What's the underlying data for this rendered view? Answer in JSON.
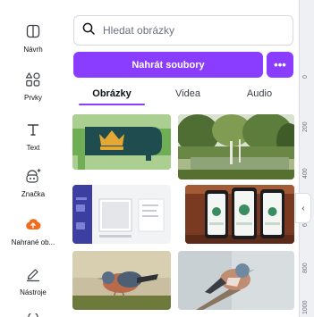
{
  "rail": {
    "items": [
      {
        "label": "Návrh",
        "icon": "layout-icon"
      },
      {
        "label": "Prvky",
        "icon": "shapes-icon"
      },
      {
        "label": "Text",
        "icon": "text-icon"
      },
      {
        "label": "Značka",
        "icon": "brand-icon"
      },
      {
        "label": "Nahrané ob...",
        "icon": "upload-cloud-icon"
      },
      {
        "label": "Nástroje",
        "icon": "draw-tool-icon"
      }
    ],
    "active_index": 4,
    "accent_color": "#f26a1b"
  },
  "search": {
    "placeholder": "Hledat obrázky"
  },
  "upload": {
    "label": "Nahrát soubory",
    "more_label": "•••",
    "color": "#8b3dff"
  },
  "tabs": [
    {
      "label": "Obrázky",
      "active": true
    },
    {
      "label": "Videa",
      "active": false
    },
    {
      "label": "Audio",
      "active": false
    }
  ],
  "thumbnails": [
    {
      "name": "crown-logo-thumbnail"
    },
    {
      "name": "forest-pond-thumbnail"
    },
    {
      "name": "app-screenshot-thumbnail"
    },
    {
      "name": "phones-thumbnail"
    },
    {
      "name": "chaffinch-thumbnail"
    },
    {
      "name": "chaffinch-branch-thumbnail"
    }
  ],
  "ruler": {
    "ticks": [
      "0",
      "200",
      "400",
      "600",
      "800",
      "1000"
    ]
  },
  "collapse_label": "‹"
}
